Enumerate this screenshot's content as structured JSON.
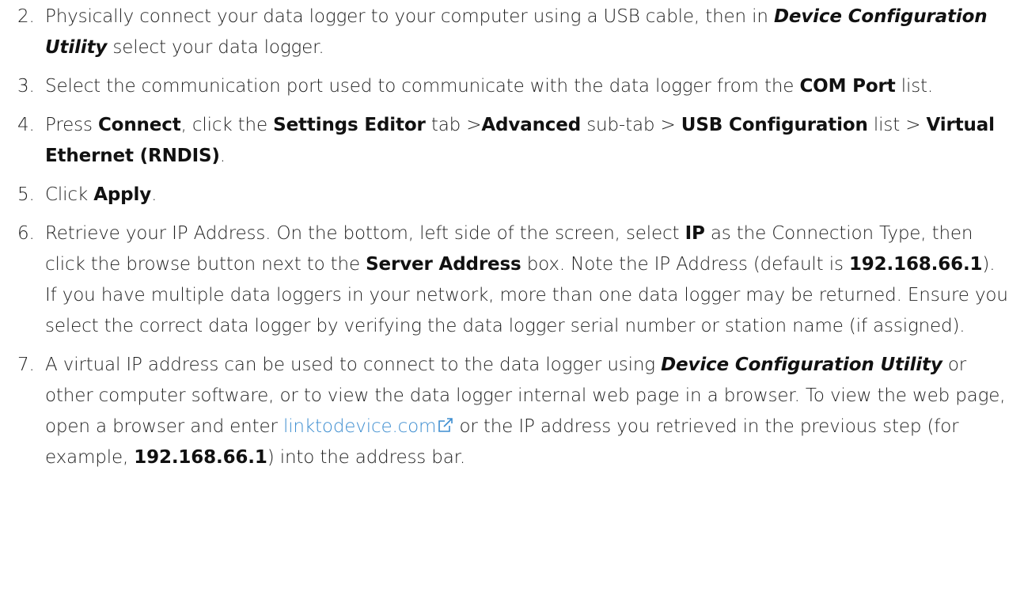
{
  "steps": [
    {
      "num": "2.",
      "parts": [
        {
          "t": "text",
          "v": "Physically connect your data logger to your computer using a USB cable, then in "
        },
        {
          "t": "bi",
          "v": "Device Configuration Utility"
        },
        {
          "t": "text",
          "v": " select your data logger."
        }
      ]
    },
    {
      "num": "3.",
      "parts": [
        {
          "t": "text",
          "v": "Select the communication port used to communicate with the data logger from the "
        },
        {
          "t": "b",
          "v": "COM Port"
        },
        {
          "t": "text",
          "v": " list."
        }
      ]
    },
    {
      "num": "4.",
      "parts": [
        {
          "t": "text",
          "v": "Press "
        },
        {
          "t": "b",
          "v": "Connect"
        },
        {
          "t": "text",
          "v": ", click the "
        },
        {
          "t": "b",
          "v": "Settings Editor"
        },
        {
          "t": "text",
          "v": " tab >"
        },
        {
          "t": "b",
          "v": "Advanced"
        },
        {
          "t": "text",
          "v": " sub-tab > "
        },
        {
          "t": "b",
          "v": "USB Configuration"
        },
        {
          "t": "text",
          "v": " list > "
        },
        {
          "t": "b",
          "v": "Virtual Ethernet (RNDIS)"
        },
        {
          "t": "text",
          "v": "."
        }
      ]
    },
    {
      "num": "5.",
      "parts": [
        {
          "t": "text",
          "v": "Click "
        },
        {
          "t": "b",
          "v": "Apply"
        },
        {
          "t": "text",
          "v": "."
        }
      ]
    },
    {
      "num": "6.",
      "parts": [
        {
          "t": "text",
          "v": "Retrieve your IP Address. On the bottom, left side of the screen, select "
        },
        {
          "t": "b",
          "v": "IP"
        },
        {
          "t": "text",
          "v": " as the Connection Type, then click the browse button next to the "
        },
        {
          "t": "b",
          "v": "Server Address"
        },
        {
          "t": "text",
          "v": " box. Note the IP Address (default is "
        },
        {
          "t": "b",
          "v": "192.168.66.1"
        },
        {
          "t": "text",
          "v": "). If you have multiple data loggers in your network, more than one data logger may be returned. Ensure you select the correct data logger by verifying the data logger serial number or station name (if assigned)."
        }
      ]
    },
    {
      "num": "7.",
      "parts": [
        {
          "t": "text",
          "v": "A virtual IP address can be used to connect to the data logger using "
        },
        {
          "t": "bi",
          "v": "Device Configuration Utility"
        },
        {
          "t": "text",
          "v": " or other computer software, or to view the data logger internal web page in a browser. To view the web page, open a browser and enter "
        },
        {
          "t": "link",
          "v": "linktodevice.com"
        },
        {
          "t": "text",
          "v": " or the IP address you retrieved in the previous step (for example, "
        },
        {
          "t": "b",
          "v": "192.168.66.1"
        },
        {
          "t": "text",
          "v": ") into the address bar."
        }
      ]
    }
  ],
  "link_color": "#3e8ed0",
  "icons": {
    "external_link": "external-link-icon"
  }
}
